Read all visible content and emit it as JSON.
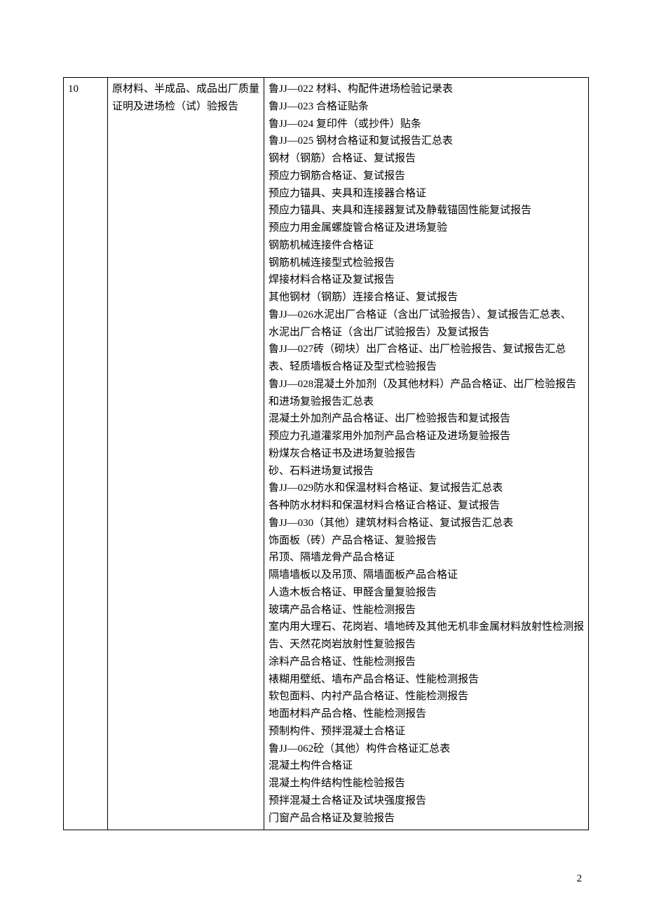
{
  "row": {
    "number": "10",
    "description": "原材料、半成品、成品出厂质量证明及进场检（试）验报告",
    "items": [
      "鲁JJ—022 材料、构配件进场检验记录表",
      "鲁JJ—023 合格证贴条",
      "鲁JJ—024 复印件（或抄件）贴条",
      "鲁JJ—025 钢材合格证和复试报告汇总表",
      "钢材（钢筋）合格证、复试报告",
      "预应力钢筋合格证、复试报告",
      "预应力锚具、夹具和连接器合格证",
      "预应力锚具、夹具和连接器复试及静载锚固性能复试报告",
      "预应力用金属螺旋管合格证及进场复验",
      "钢筋机械连接件合格证",
      "钢筋机械连接型式检验报告",
      "焊接材料合格证及复试报告",
      "其他钢材（钢筋）连接合格证、复试报告",
      "鲁JJ—026水泥出厂合格证（含出厂试验报告）、复试报告汇总表、",
      "水泥出厂合格证（含出厂试验报告）及复试报告",
      "鲁JJ—027砖（砌块）出厂合格证、出厂检验报告、复试报告汇总表、轻质墙板合格证及型式检验报告",
      "鲁JJ—028混凝土外加剂（及其他材料）产品合格证、出厂检验报告和进场复验报告汇总表",
      "混凝土外加剂产品合格证、出厂检验报告和复试报告",
      "预应力孔道灌浆用外加剂产品合格证及进场复验报告",
      "粉煤灰合格证书及进场复验报告",
      "砂、石料进场复试报告",
      "鲁JJ—029防水和保温材料合格证、复试报告汇总表",
      "各种防水材料和保温材料合格证合格证、复试报告",
      "鲁JJ—030（其他）建筑材料合格证、复试报告汇总表",
      "饰面板（砖）产品合格证、复验报告",
      "吊顶、隔墙龙骨产品合格证",
      "隔墙墙板以及吊顶、隔墙面板产品合格证",
      "人造木板合格证、甲醛含量复验报告",
      "玻璃产品合格证、性能检测报告",
      "室内用大理石、花岗岩、墙地砖及其他无机非金属材料放射性检测报告、天然花岗岩放射性复验报告",
      "涂料产品合格证、性能检测报告",
      "裱糊用壁纸、墙布产品合格证、性能检测报告",
      "软包面料、内衬产品合格证、性能检测报告",
      "地面材料产品合格、性能检测报告",
      "预制构件、预拌混凝土合格证",
      "鲁JJ—062砼（其他）构件合格证汇总表",
      "混凝土构件合格证",
      "混凝土构件结构性能检验报告",
      "预拌混凝土合格证及试块强度报告",
      "门窗产品合格证及复验报告"
    ]
  },
  "page_number": "2"
}
